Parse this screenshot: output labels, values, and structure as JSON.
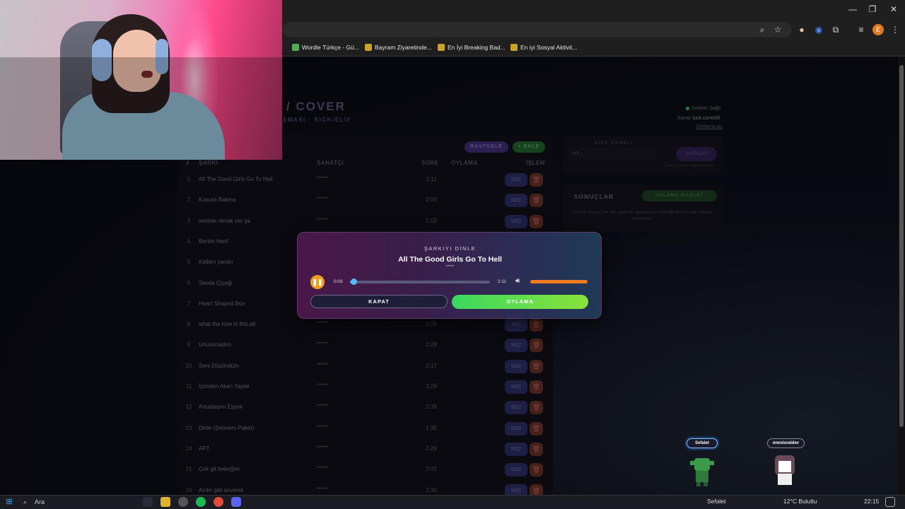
{
  "browser": {
    "bookmarks": [
      {
        "label": "Wordle Türkçe - Gü...",
        "icon": "wordle-icon",
        "color": "#4caf50"
      },
      {
        "label": "Bayram Ziyaretinde...",
        "icon": "bookmark-icon",
        "color": "#c9a227"
      },
      {
        "label": "En İyi Breaking Bad...",
        "icon": "bookmark-icon",
        "color": "#c9a227"
      },
      {
        "label": "En iyi Sosyal Aktivit...",
        "icon": "bookmark-icon",
        "color": "#c9a227"
      }
    ],
    "profile_initial": "E"
  },
  "header": {
    "title": "/ COVER",
    "subtitle": "ŞMASI · KICK/ELİF",
    "status": "Sohbet: bağlı",
    "channel_label": "Kanal:",
    "channel_value": "kick.com/elif",
    "settings_link": "Sıfırlama aç"
  },
  "table": {
    "random_label": "RASTGELE",
    "add_label": "+ EKLE",
    "headers": {
      "num": "#",
      "song": "ŞARKI",
      "artist": "SANATÇI",
      "duration": "SÜRE",
      "vote": "OYLAMA",
      "action": "İŞLEM"
    },
    "select_label": "SEÇ",
    "rows": [
      {
        "num": "1",
        "name": "All The Good Girls Go To Hell",
        "artist": "*****",
        "dur": "2:11"
      },
      {
        "num": "2",
        "name": "Kusura Bakma",
        "artist": "*****",
        "dur": "2:00"
      },
      {
        "num": "3",
        "name": "seninle olmak var ya",
        "artist": "*****",
        "dur": "1:59"
      },
      {
        "num": "4",
        "name": "Benim Herif",
        "artist": "",
        "dur": ""
      },
      {
        "num": "5",
        "name": "Kalbim yaralıı",
        "artist": "",
        "dur": ""
      },
      {
        "num": "6",
        "name": "Sevda Çiçeği",
        "artist": "",
        "dur": ""
      },
      {
        "num": "7",
        "name": "Heart Shaped Box",
        "artist": "",
        "dur": ""
      },
      {
        "num": "8",
        "name": "what the love is this ah",
        "artist": "*****",
        "dur": "2:29"
      },
      {
        "num": "9",
        "name": "Unutamadım",
        "artist": "*****",
        "dur": "2:28"
      },
      {
        "num": "10",
        "name": "Seni Düşündüm",
        "artist": "*****",
        "dur": "2:17"
      },
      {
        "num": "11",
        "name": "İçimden Akan Yaşlar",
        "artist": "*****",
        "dur": "2:29"
      },
      {
        "num": "12",
        "name": "Arkadaşım Eşşek",
        "artist": "*****",
        "dur": "2:38"
      },
      {
        "num": "13",
        "name": "Dinle (Şebnem Paker)",
        "artist": "*****",
        "dur": "1:35"
      },
      {
        "num": "14",
        "name": "APT",
        "artist": "*****",
        "dur": "2:29"
      },
      {
        "num": "15",
        "name": "Çek git bebeğim",
        "artist": "*****",
        "dur": "2:01"
      },
      {
        "num": "16",
        "name": "Acıtır gibi severek",
        "artist": "*****",
        "dur": "2:30"
      }
    ]
  },
  "kick_panel": {
    "label": "KICK KANALI",
    "input_value": "elif",
    "connect_label": "BAĞLAN",
    "note": "Connected to kick.com/elif"
  },
  "results": {
    "title": "SONUÇLAR",
    "start_label": "OYLAMA BAŞLAT",
    "empty_text": "Henüz sonuç yok. Bir şarkının oylamasını bitirdiğinde burada oylama belirecek."
  },
  "modal": {
    "label": "ŞARKIYI DİNLE",
    "title": "All The Good Girls Go To Hell",
    "artist": "*****",
    "current_time": "0:03",
    "duration": "2:11",
    "progress": 0.025,
    "volume": 1.0,
    "close_label": "KAPAT",
    "vote_label": "OYLAMA"
  },
  "avatars": [
    {
      "name": "Sefalet",
      "active": true
    },
    {
      "name": "enesturaldev",
      "active": false
    }
  ],
  "taskbar": {
    "search": "Ara",
    "tray_user": "Sefalet",
    "weather": "12°C  Bulutlu",
    "time": "22:15"
  }
}
